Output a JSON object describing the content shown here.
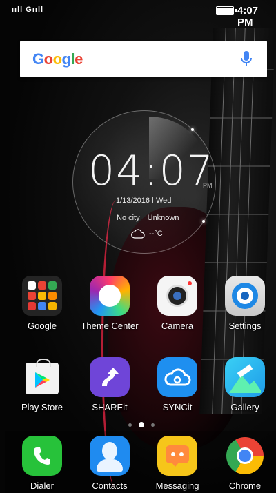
{
  "status_bar": {
    "signal": "ııll Gııll",
    "time": "4:07 PM",
    "battery_level": 1.0
  },
  "search": {
    "logo": [
      "G",
      "o",
      "o",
      "g",
      "l",
      "e"
    ],
    "mic_icon": "microphone-icon"
  },
  "clock": {
    "time": "04:07",
    "ampm": "PM",
    "date": "1/13/2016",
    "day": "Wed",
    "city": "No city",
    "weather_state": "Unknown",
    "temp": "--°C",
    "weather_icon": "cloud-icon"
  },
  "apps_row1": [
    {
      "label": "Google",
      "icon": "google-folder-icon"
    },
    {
      "label": "Theme Center",
      "icon": "theme-center-icon"
    },
    {
      "label": "Camera",
      "icon": "camera-icon"
    },
    {
      "label": "Settings",
      "icon": "settings-icon"
    }
  ],
  "apps_row2": [
    {
      "label": "Play Store",
      "icon": "play-store-icon"
    },
    {
      "label": "SHAREit",
      "icon": "shareit-icon"
    },
    {
      "label": "SYNCit",
      "icon": "syncit-icon"
    },
    {
      "label": "Gallery",
      "icon": "gallery-icon"
    }
  ],
  "dock": [
    {
      "label": "Dialer",
      "icon": "phone-icon"
    },
    {
      "label": "Contacts",
      "icon": "contacts-icon"
    },
    {
      "label": "Messaging",
      "icon": "messaging-icon"
    },
    {
      "label": "Chrome",
      "icon": "chrome-icon"
    }
  ],
  "page_indicator": {
    "pages": 3,
    "current": 2
  },
  "colors": {
    "google_blue": "#4285F4",
    "google_red": "#EA4335",
    "google_yellow": "#FBBC05",
    "google_green": "#34A853",
    "dialer_green": "#27c23a",
    "contacts_blue": "#1f8bf0",
    "messaging_yellow": "#f6c61a",
    "shareit_purple": "#6f45d8",
    "syncit_blue": "#1e8ff0"
  }
}
